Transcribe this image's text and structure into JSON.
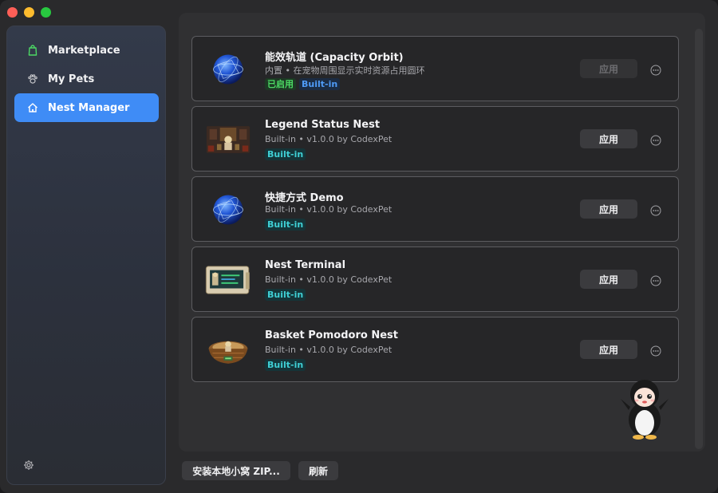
{
  "sidebar": {
    "items": [
      {
        "label": "Marketplace",
        "icon": "bag-icon"
      },
      {
        "label": "My Pets",
        "icon": "paw-icon"
      },
      {
        "label": "Nest Manager",
        "icon": "home-icon",
        "active": true
      }
    ]
  },
  "nests": [
    {
      "title": "能效轨道 (Capacity Orbit)",
      "subtitle": "内置 • 在宠物周围显示实时资源占用圆环",
      "tags": [
        "已启用",
        "Built-in"
      ],
      "apply_label": "应用",
      "apply_disabled": true,
      "thumb": "orbit-sphere"
    },
    {
      "title": "Legend Status Nest",
      "subtitle": "Built-in • v1.0.0 by CodexPet",
      "tags": [
        "Built-in"
      ],
      "apply_label": "应用",
      "thumb": "legend-room"
    },
    {
      "title": "快捷方式 Demo",
      "subtitle": "Built-in • v1.0.0 by CodexPet",
      "tags": [
        "Built-in"
      ],
      "apply_label": "应用",
      "thumb": "orbit-sphere"
    },
    {
      "title": "Nest Terminal",
      "subtitle": "Built-in • v1.0.0 by CodexPet",
      "tags": [
        "Built-in"
      ],
      "apply_label": "应用",
      "thumb": "terminal-screen"
    },
    {
      "title": "Basket Pomodoro Nest",
      "subtitle": "Built-in • v1.0.0 by CodexPet",
      "tags": [
        "Built-in"
      ],
      "apply_label": "应用",
      "thumb": "basket"
    }
  ],
  "footer": {
    "install_label": "安装本地小窝 ZIP...",
    "refresh_label": "刷新"
  },
  "colors": {
    "accent": "#3f8cf6",
    "enabled_tag": "#4cd964",
    "builtin_blue": "#4f9bf7",
    "builtin_teal": "#3fd0d6"
  }
}
